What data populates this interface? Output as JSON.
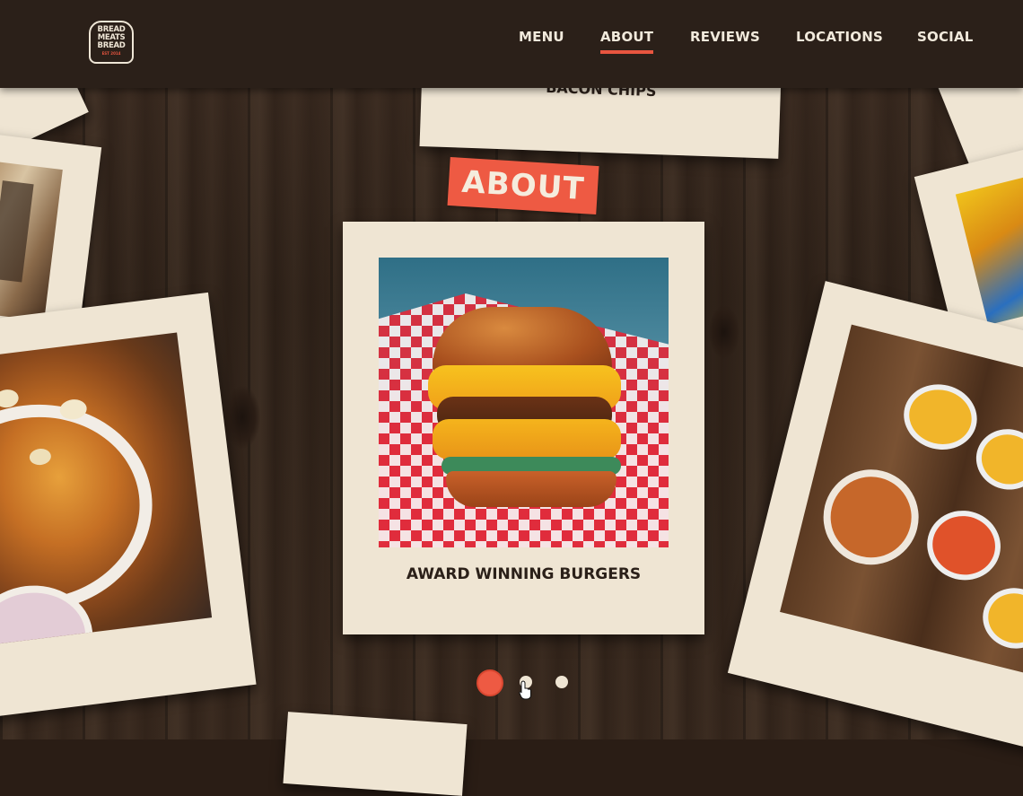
{
  "brand": {
    "logo_lines": [
      "BREAD",
      "MEATS",
      "BREAD"
    ],
    "logo_est": "EST 2014",
    "accent": "#e8553f"
  },
  "nav": {
    "items": [
      {
        "label": "MENU",
        "active": false
      },
      {
        "label": "ABOUT",
        "active": true
      },
      {
        "label": "REVIEWS",
        "active": false
      },
      {
        "label": "LOCATIONS",
        "active": false
      },
      {
        "label": "SOCIAL",
        "active": false
      }
    ]
  },
  "section": {
    "badge": "ABOUT"
  },
  "polaroids": {
    "top_caption": "BACON CHIPS",
    "center_caption": "AWARD WINNING BURGERS"
  },
  "carousel": {
    "current": 1,
    "total": 3
  },
  "colors": {
    "header_bg": "#2b2019",
    "paper": "#efe5d3",
    "accent": "#ee5a43"
  }
}
